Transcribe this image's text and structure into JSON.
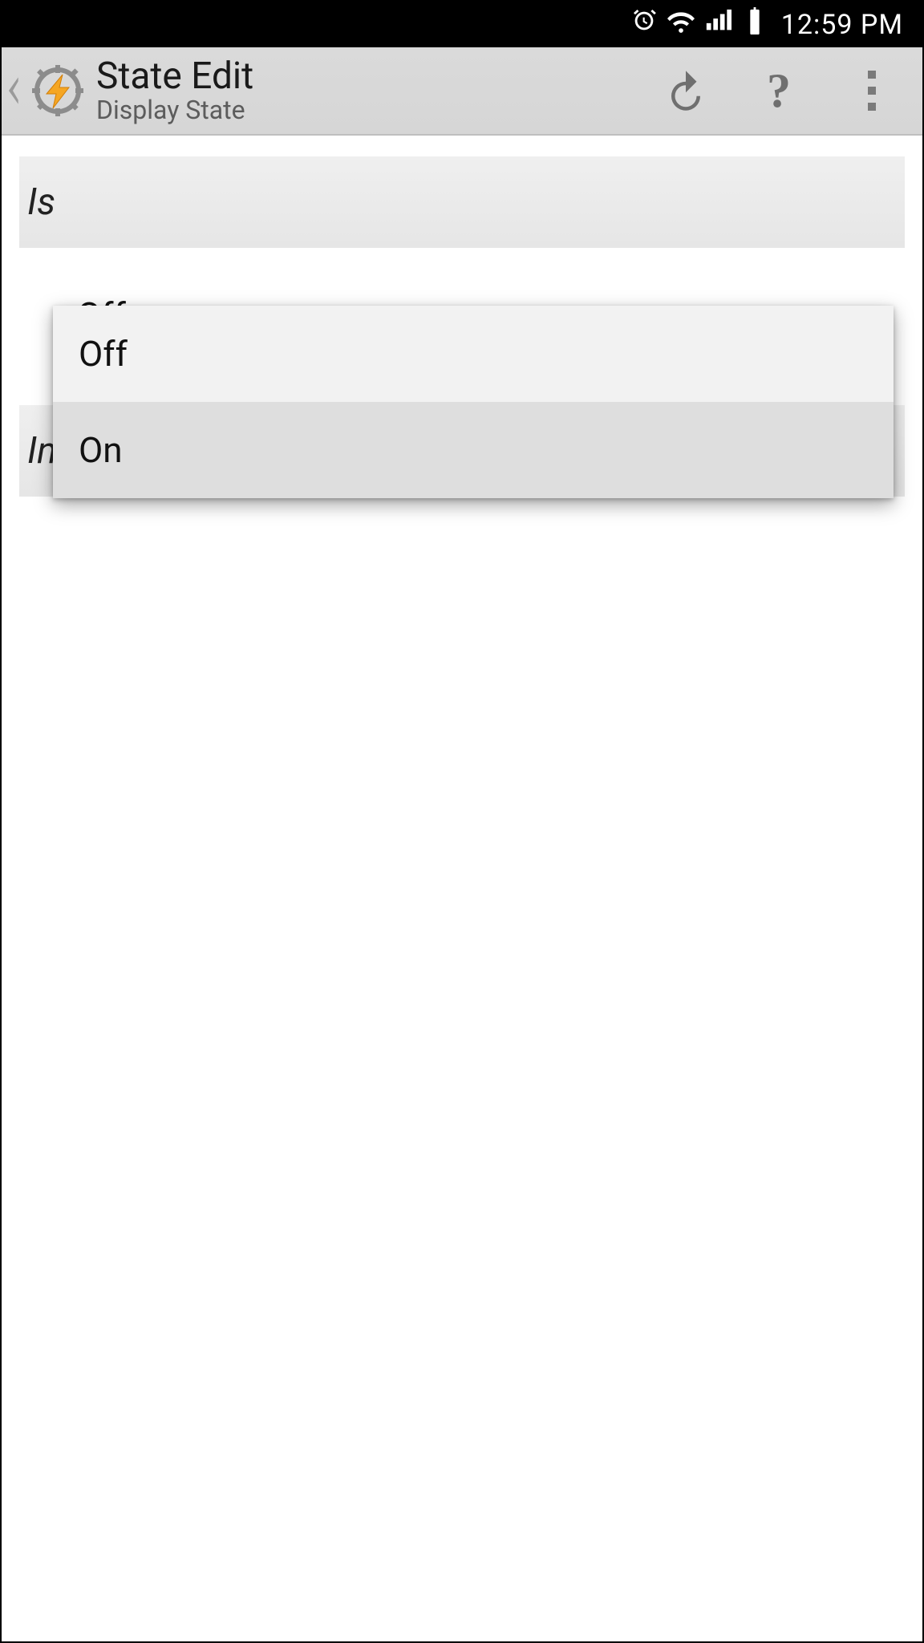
{
  "statusbar": {
    "time": "12:59 PM"
  },
  "actionbar": {
    "title": "State Edit",
    "subtitle": "Display State"
  },
  "section": {
    "is_label": "Is",
    "invert_label": "In"
  },
  "spinner": {
    "selected": "Off",
    "options": [
      "Off",
      "On"
    ]
  }
}
